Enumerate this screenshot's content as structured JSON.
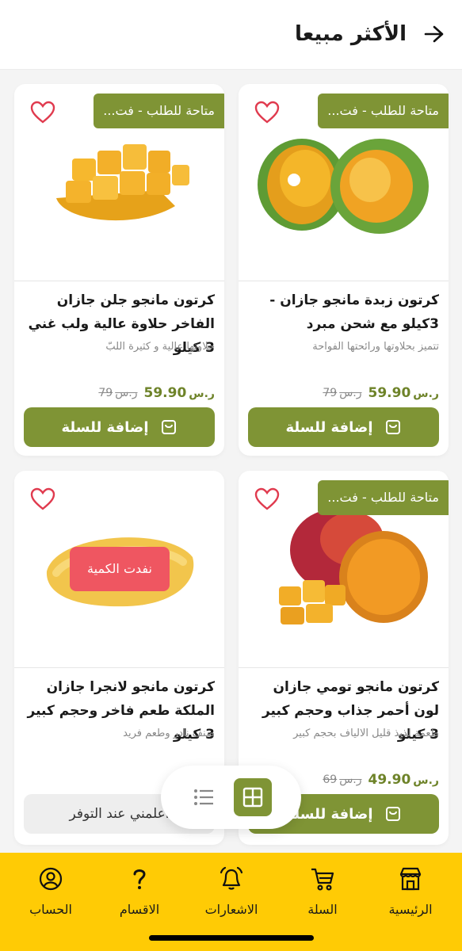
{
  "header": {
    "title": "الأكثر مبيعا"
  },
  "products": [
    {
      "badge": "متاحة للطلب - فت...",
      "name": "كرتون زبدة مانجو جازان - 3كيلو مع شحن مبرد",
      "desc": "تتميز بحلاوتها ورائحتها الفواحة",
      "price": "59.90",
      "old_price": "79",
      "button": "إضافة للسلة"
    },
    {
      "badge": "متاحة للطلب - فت...",
      "name": "كرتون مانجو جلن جازان الفاخر حلاوة عالية ولب غني 3 كيلو",
      "desc": "حلاوتها عالية و كثيرة اللبّ",
      "price": "59.90",
      "old_price": "79",
      "button": "إضافة للسلة"
    },
    {
      "badge": "متاحة للطلب - فت...",
      "name": "كرتون مانجو تومي جازان لون أحمر جذاب وحجم كبير 3 كيلو",
      "desc": "طعمة لذيذ قليل الالياف بحجم كبير",
      "price": "49.90",
      "old_price": "69",
      "button": "إضافة للسلة"
    },
    {
      "soldout": "نفدت الكمية",
      "name": "كرتون مانجو لانجرا جازان الملكة طعم فاخر وحجم كبير 3 كيلو",
      "desc": "صنف نادر وطعم فريد",
      "button": "اعلمني عند التوفر"
    }
  ],
  "currency": "ر.س",
  "nav": {
    "home": "الرئيسية",
    "cart": "السلة",
    "notifications": "الاشعارات",
    "categories": "الاقسام",
    "account": "الحساب"
  },
  "colors": {
    "accent": "#7f9435",
    "nav_bg": "#ffcb05",
    "soldout": "#ef5661"
  }
}
